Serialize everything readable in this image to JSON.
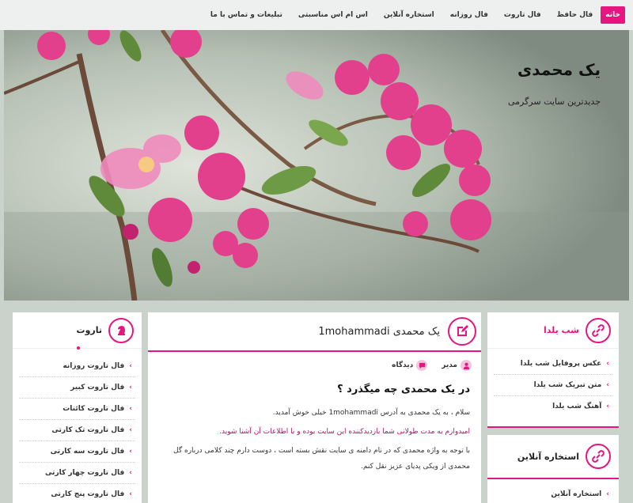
{
  "nav": {
    "items": [
      {
        "label": "خانه",
        "active": true
      },
      {
        "label": "فال حافظ"
      },
      {
        "label": "فال تاروت"
      },
      {
        "label": "فال روزانه"
      },
      {
        "label": "استخاره آنلاین"
      },
      {
        "label": "اس ام اس مناسبتی"
      },
      {
        "label": "تبلیغات و تماس با ما"
      }
    ]
  },
  "header": {
    "title": "یک محمدی",
    "tagline": "جدیدترین سایت سرگرمی"
  },
  "left_panel": {
    "title": "تاروت",
    "items": [
      "فال تاروت روزانه",
      "فال تاروت کبیر",
      "فال تاروت کائنات",
      "فال تاروت تک کارتی",
      "فال تاروت سه کارتی",
      "فال تاروت چهار کارتی",
      "فال تاروت پنج کارتی"
    ]
  },
  "article": {
    "title": "یک محمدی 1mohammadi",
    "meta_author": "مدیر",
    "meta_comments": "دیدگاه",
    "heading": "در یک محمدی چه میگذرد ؟",
    "p1": "سلام ، به یک محمدی به آدرس 1mohammadi خیلی خوش آمدید.",
    "p2": "امیدوارم به مدت طولانی شما بازدیدکننده این سایت بوده و با اطلاعات آن آشنا شوید.",
    "p3": "با توجه به واژه محمدی که در نام دامنه ی سایت نقش بسته است ، دوست دارم چند کلامی درباره گل محمدی از ویکی پدیای عزیز نقل کنم."
  },
  "right_panel_1": {
    "title": "شب یلدا",
    "items": [
      "عکس پروفایل شب یلدا",
      "متن تبریک شب یلدا",
      "آهنگ شب یلدا"
    ]
  },
  "right_panel_2": {
    "title": "استخاره آنلاین",
    "items": [
      "استخاره آنلاین"
    ]
  },
  "colors": {
    "accent": "#e6157f",
    "nav_bg": "#eef0ef",
    "page_bg": "#c9d3cc"
  }
}
